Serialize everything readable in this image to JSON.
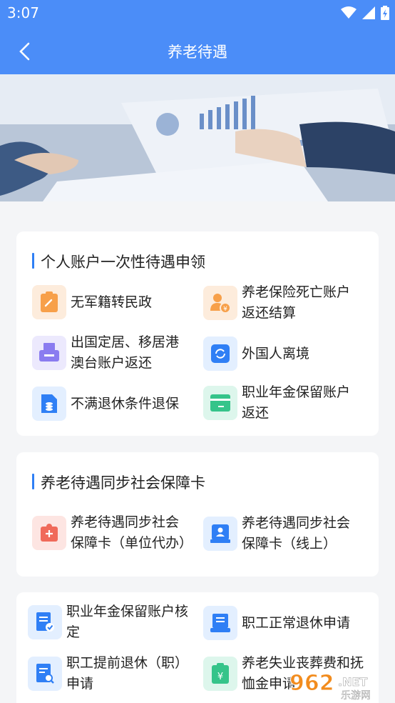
{
  "status_bar": {
    "time": "3:07"
  },
  "header": {
    "title": "养老待遇"
  },
  "section1": {
    "title": "个人账户一次性待遇申领",
    "items": [
      {
        "label": "无军籍转民政"
      },
      {
        "label": "养老保险死亡账户返还结算"
      },
      {
        "label": "出国定居、移居港澳台账户返还"
      },
      {
        "label": "外国人离境"
      },
      {
        "label": "不满退休条件退保"
      },
      {
        "label": "职业年金保留账户返还"
      }
    ]
  },
  "section2": {
    "title": "养老待遇同步社会保障卡",
    "items": [
      {
        "label": "养老待遇同步社会保障卡（单位代办）"
      },
      {
        "label": "养老待遇同步社会保障卡（线上）"
      }
    ]
  },
  "section3": {
    "items": [
      {
        "label": "职业年金保留账户核定"
      },
      {
        "label": "职工正常退休申请"
      },
      {
        "label": "职工提前退休（职）申请"
      },
      {
        "label": "养老失业丧葬费和抚恤金申请"
      }
    ]
  },
  "watermark": {
    "brand": "962.NET",
    "sub": "乐游网"
  },
  "colors": {
    "primary": "#4b8df8",
    "accent": "#2f7ff5",
    "orange": "#f7a04a",
    "purple": "#8a7cf0",
    "blue": "#2f7ff5",
    "green": "#35c48a",
    "red": "#f06a5a"
  }
}
